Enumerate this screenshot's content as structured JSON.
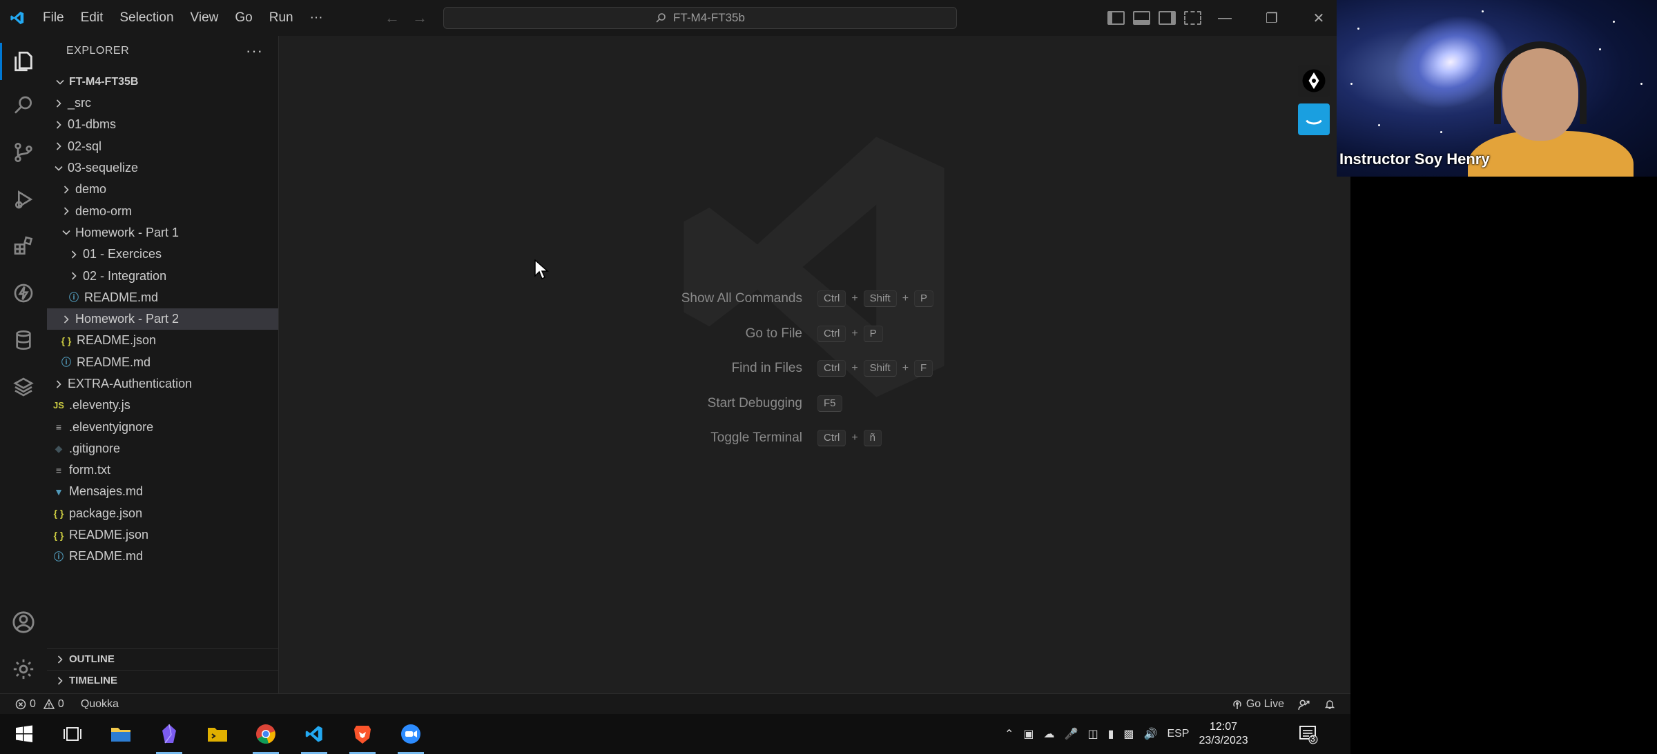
{
  "titlebar": {
    "menu": [
      "File",
      "Edit",
      "Selection",
      "View",
      "Go",
      "Run",
      "···"
    ],
    "command_center": "FT-M4-FT35b"
  },
  "explorer": {
    "title": "EXPLORER",
    "more": "···",
    "root": "FT-M4-FT35B",
    "items": [
      {
        "label": "_src",
        "depth": 1,
        "kind": "folder",
        "expanded": false
      },
      {
        "label": "01-dbms",
        "depth": 1,
        "kind": "folder",
        "expanded": false
      },
      {
        "label": "02-sql",
        "depth": 1,
        "kind": "folder",
        "expanded": false
      },
      {
        "label": "03-sequelize",
        "depth": 1,
        "kind": "folder",
        "expanded": true
      },
      {
        "label": "demo",
        "depth": 2,
        "kind": "folder",
        "expanded": false
      },
      {
        "label": "demo-orm",
        "depth": 2,
        "kind": "folder",
        "expanded": false
      },
      {
        "label": "Homework - Part 1",
        "depth": 2,
        "kind": "folder",
        "expanded": true
      },
      {
        "label": "01 - Exercices",
        "depth": 3,
        "kind": "folder",
        "expanded": false
      },
      {
        "label": "02 - Integration",
        "depth": 3,
        "kind": "folder",
        "expanded": false
      },
      {
        "label": "README.md",
        "depth": 3,
        "kind": "info"
      },
      {
        "label": "Homework - Part 2",
        "depth": 2,
        "kind": "folder",
        "expanded": false,
        "selected": true
      },
      {
        "label": "README.json",
        "depth": 2,
        "kind": "json"
      },
      {
        "label": "README.md",
        "depth": 2,
        "kind": "info"
      },
      {
        "label": "EXTRA-Authentication",
        "depth": 1,
        "kind": "folder",
        "expanded": false
      },
      {
        "label": ".eleventy.js",
        "depth": 1,
        "kind": "js"
      },
      {
        "label": ".eleventyignore",
        "depth": 1,
        "kind": "lines"
      },
      {
        "label": ".gitignore",
        "depth": 1,
        "kind": "git"
      },
      {
        "label": "form.txt",
        "depth": 1,
        "kind": "lines"
      },
      {
        "label": "Mensajes.md",
        "depth": 1,
        "kind": "md"
      },
      {
        "label": "package.json",
        "depth": 1,
        "kind": "json"
      },
      {
        "label": "README.json",
        "depth": 1,
        "kind": "json"
      },
      {
        "label": "README.md",
        "depth": 1,
        "kind": "info"
      }
    ],
    "outline": "OUTLINE",
    "timeline": "TIMELINE"
  },
  "welcome": {
    "shortcuts": [
      {
        "label": "Show All Commands",
        "keys": [
          "Ctrl",
          "Shift",
          "P"
        ]
      },
      {
        "label": "Go to File",
        "keys": [
          "Ctrl",
          "P"
        ]
      },
      {
        "label": "Find in Files",
        "keys": [
          "Ctrl",
          "Shift",
          "F"
        ]
      },
      {
        "label": "Start Debugging",
        "keys": [
          "F5"
        ]
      },
      {
        "label": "Toggle Terminal",
        "keys": [
          "Ctrl",
          "ñ"
        ]
      }
    ]
  },
  "statusbar": {
    "errors": "0",
    "warnings": "0",
    "quokka": "Quokka",
    "go_live": "Go Live"
  },
  "webcam": {
    "name": "Instructor Soy Henry"
  },
  "taskbar": {
    "language": "ESP",
    "time": "12:07",
    "date": "23/3/2023",
    "notifications": "3"
  },
  "colors": {
    "accent": "#0078d4",
    "editor_bg": "#1f1f1f",
    "sidebar_bg": "#181818",
    "selected_row": "#37373d"
  }
}
